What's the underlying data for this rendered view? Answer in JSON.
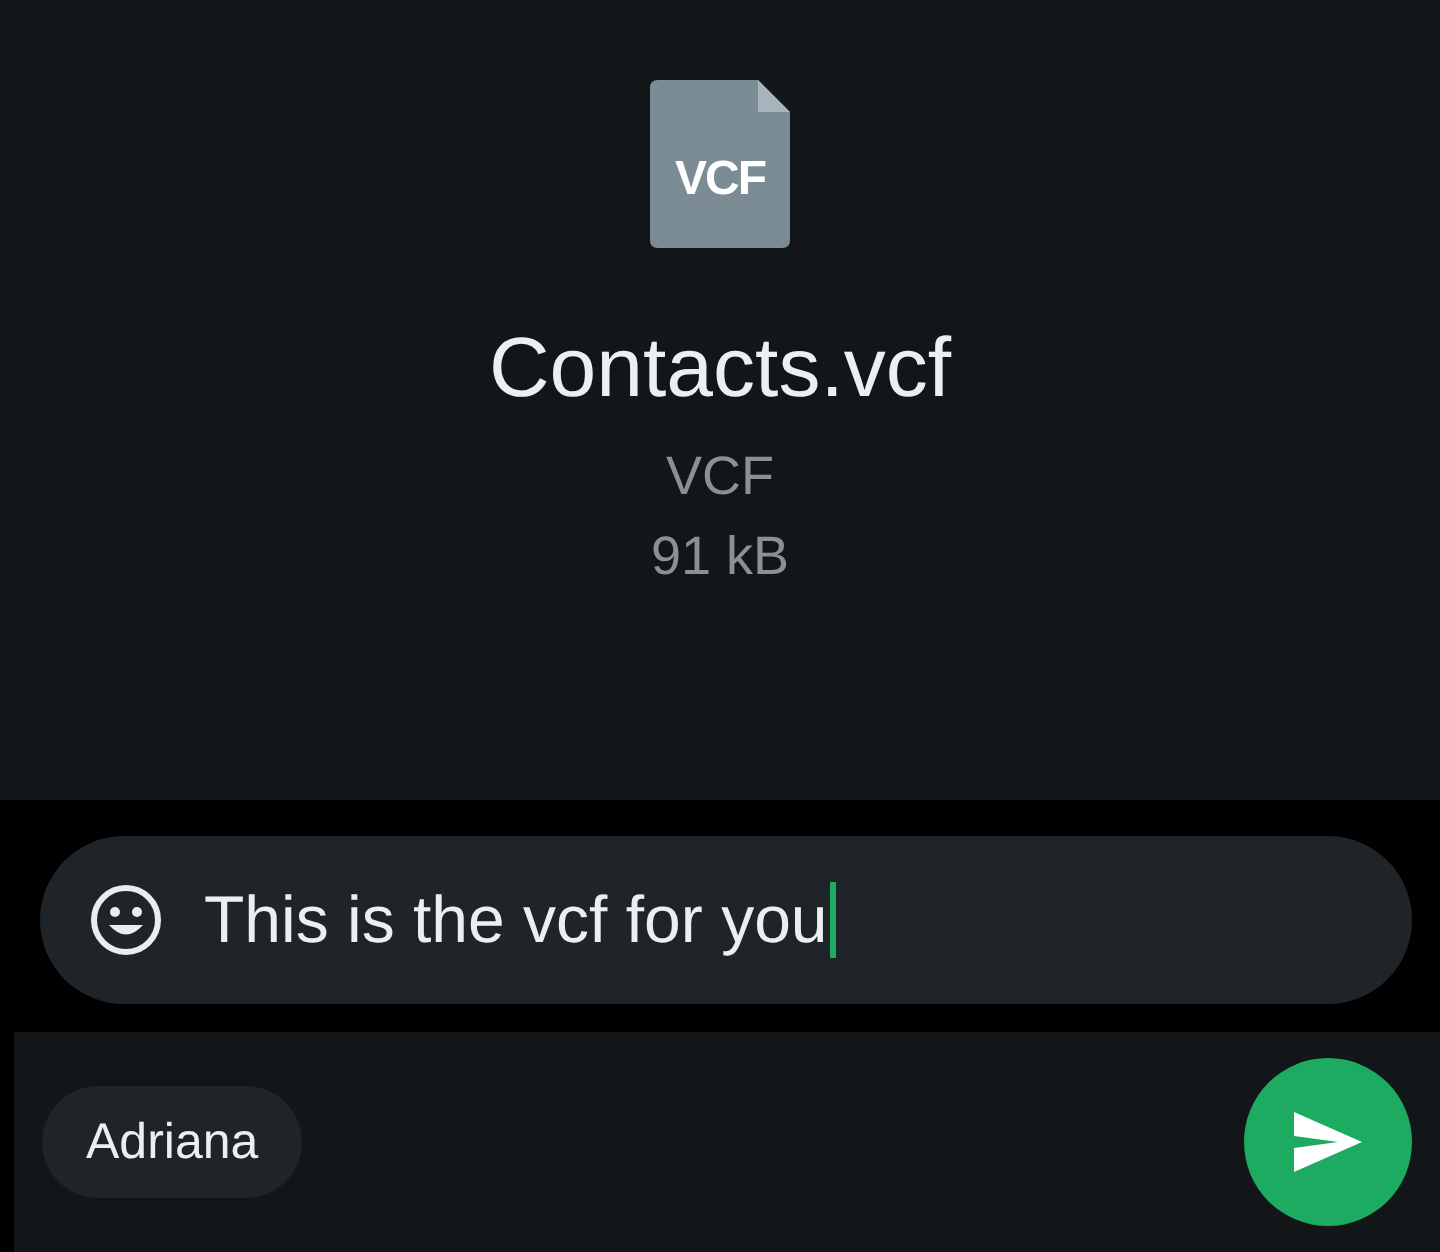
{
  "file": {
    "icon_label": "VCF",
    "name": "Contacts.vcf",
    "type": "VCF",
    "size": "91 kB"
  },
  "caption": {
    "value": "This is the vcf for you",
    "focused": true
  },
  "recipients": [
    {
      "name": "Adriana"
    }
  ]
}
